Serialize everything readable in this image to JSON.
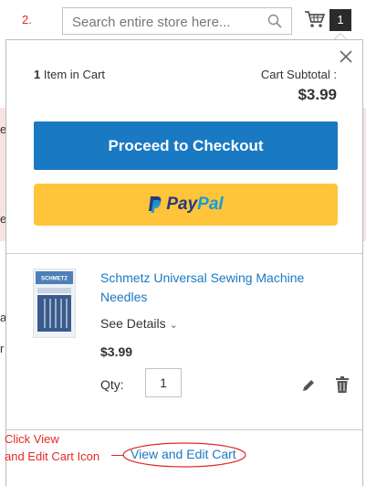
{
  "step_number": "2.",
  "search": {
    "placeholder": "Search entire store here..."
  },
  "header": {
    "cart_count": "1"
  },
  "background_letters": [
    "e",
    "e",
    "a",
    "r"
  ],
  "minicart": {
    "items_count": "1",
    "items_label": "Item in Cart",
    "subtotal_label": "Cart Subtotal :",
    "subtotal_amount": "$3.99",
    "checkout_label": "Proceed to Checkout",
    "paypal_label_pay": "Pay",
    "paypal_label_pal": "Pal",
    "item": {
      "name": "Schmetz Universal Sewing Machine Needles",
      "image_brand": "SCHMETZ",
      "see_details": "See Details",
      "price": "$3.99",
      "qty_label": "Qty:",
      "qty_value": "1"
    },
    "view_edit_label": "View and Edit Cart"
  },
  "annotation": {
    "line1": "Click View",
    "line2": "and Edit Cart Icon"
  },
  "colors": {
    "accent_blue": "#1979c3",
    "paypal_yellow": "#ffc439",
    "annotation_red": "#e02b27"
  }
}
